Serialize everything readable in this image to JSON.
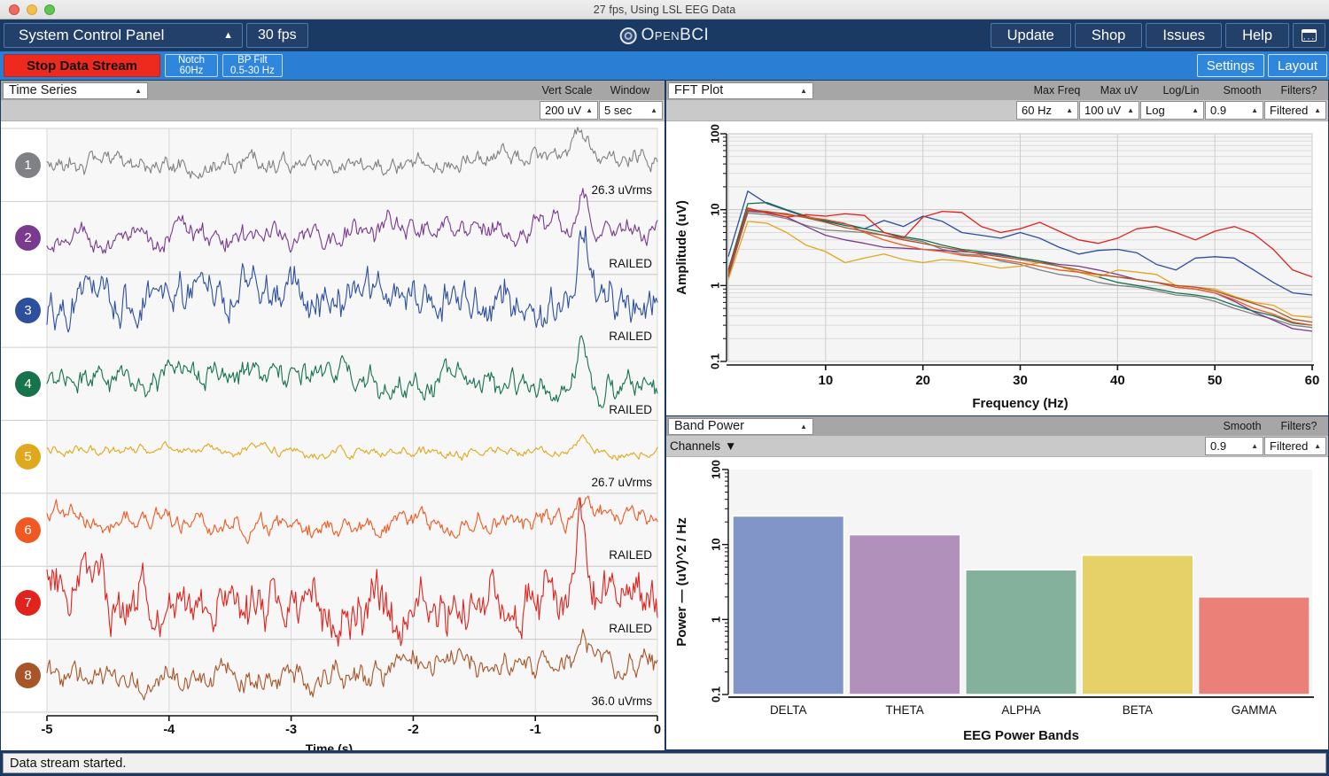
{
  "window": {
    "title": "27 fps, Using LSL EEG Data",
    "traffic_lights": [
      "close",
      "minimize",
      "zoom"
    ]
  },
  "navbar": {
    "system_control_panel": "System Control Panel",
    "caret": "▲",
    "fps": "30 fps",
    "logo": "OpenBCI",
    "update": "Update",
    "shop": "Shop",
    "issues": "Issues",
    "help": "Help",
    "window_icon": "window-icon"
  },
  "subbar": {
    "stop_button": "Stop Data Stream",
    "notch_line1": "Notch",
    "notch_line2": "60Hz",
    "bpfilt_line1": "BP Filt",
    "bpfilt_line2": "0.5-30 Hz",
    "settings": "Settings",
    "layout": "Layout"
  },
  "time_series": {
    "title": "Time Series",
    "controls": [
      {
        "label": "Vert Scale",
        "value": "200 uV"
      },
      {
        "label": "Window",
        "value": "5 sec"
      }
    ],
    "channels": [
      {
        "num": "1",
        "color": "#808184",
        "status": "26.3 uVrms"
      },
      {
        "num": "2",
        "color": "#7a3a8f",
        "status": "RAILED"
      },
      {
        "num": "3",
        "color": "#2c4f9e",
        "status": "RAILED"
      },
      {
        "num": "4",
        "color": "#16734b",
        "status": "RAILED"
      },
      {
        "num": "5",
        "color": "#e0a81c",
        "status": "26.7 uVrms"
      },
      {
        "num": "6",
        "color": "#f05a22",
        "status": "RAILED"
      },
      {
        "num": "7",
        "color": "#e1221d",
        "status": "RAILED"
      },
      {
        "num": "8",
        "color": "#a85529",
        "status": "36.0 uVrms"
      }
    ],
    "xlabel": "Time (s)",
    "xticks": [
      "-5",
      "-4",
      "-3",
      "-2",
      "-1",
      "0"
    ]
  },
  "fft": {
    "title": "FFT Plot",
    "controls": [
      {
        "label": "Max Freq",
        "value": "60 Hz"
      },
      {
        "label": "Max uV",
        "value": "100 uV"
      },
      {
        "label": "Log/Lin",
        "value": "Log"
      },
      {
        "label": "Smooth",
        "value": "0.9"
      },
      {
        "label": "Filters?",
        "value": "Filtered"
      }
    ]
  },
  "band_power": {
    "title": "Band Power",
    "channels_button": "Channels",
    "channels_caret": "▼",
    "controls": [
      {
        "label": "Smooth",
        "value": "0.9"
      },
      {
        "label": "Filters?",
        "value": "Filtered"
      }
    ]
  },
  "status": {
    "message": "Data stream started."
  },
  "colors": {
    "nav_blue": "#1b3a63",
    "sub_blue": "#2a7fd4",
    "stop_red": "#ee2a1e",
    "widget_header": "#a6a6a6"
  },
  "chart_data": [
    {
      "id": "fft",
      "type": "line",
      "title": "FFT Plot",
      "xlabel": "Frequency (Hz)",
      "ylabel": "Amplitude (uV)",
      "xlim": [
        0,
        60
      ],
      "ylim": [
        0.1,
        100
      ],
      "yscale": "log",
      "xticks": [
        10,
        20,
        30,
        40,
        50,
        60
      ],
      "yticks": [
        0.1,
        1,
        10,
        100
      ],
      "grid": true,
      "legend": "none",
      "x": [
        0,
        2,
        4,
        6,
        8,
        10,
        12,
        14,
        16,
        18,
        20,
        22,
        24,
        26,
        28,
        30,
        32,
        34,
        36,
        38,
        40,
        42,
        44,
        46,
        48,
        50,
        52,
        54,
        56,
        58,
        60
      ],
      "series": [
        {
          "name": "Ch 1",
          "color": "#808184",
          "values": [
            1.5,
            9.0,
            8.6,
            7.6,
            6.2,
            5.4,
            5.2,
            5.0,
            4.6,
            4.2,
            3.8,
            3.0,
            2.6,
            2.5,
            2.1,
            1.9,
            1.6,
            1.4,
            1.3,
            1.1,
            1.0,
            0.95,
            0.85,
            0.75,
            0.72,
            0.62,
            0.5,
            0.42,
            0.36,
            0.3,
            0.28
          ]
        },
        {
          "name": "Ch 2",
          "color": "#7a3a8f",
          "values": [
            1.3,
            9.5,
            9.2,
            8.0,
            6.0,
            4.6,
            4.0,
            3.6,
            3.2,
            3.1,
            3.0,
            2.9,
            2.8,
            2.7,
            2.5,
            2.3,
            2.1,
            1.9,
            1.8,
            1.6,
            1.4,
            1.2,
            1.1,
            0.95,
            0.9,
            0.8,
            0.62,
            0.45,
            0.35,
            0.27,
            0.25
          ]
        },
        {
          "name": "Ch 3",
          "color": "#2c4f9e",
          "values": [
            2.4,
            17.5,
            12.0,
            9.8,
            8.0,
            7.2,
            6.5,
            5.6,
            7.2,
            6.0,
            8.2,
            7.0,
            5.0,
            4.6,
            4.2,
            5.0,
            4.2,
            3.2,
            2.6,
            2.9,
            3.0,
            2.7,
            1.9,
            1.6,
            2.3,
            2.4,
            2.3,
            1.6,
            1.1,
            0.8,
            0.75
          ]
        },
        {
          "name": "Ch 4",
          "color": "#16734b",
          "values": [
            1.6,
            12.0,
            12.4,
            10.0,
            8.2,
            7.0,
            6.2,
            5.6,
            5.0,
            4.4,
            4.0,
            3.4,
            3.0,
            2.8,
            2.6,
            2.3,
            2.1,
            1.8,
            1.5,
            1.3,
            1.1,
            1.0,
            0.9,
            0.8,
            0.75,
            0.68,
            0.55,
            0.46,
            0.4,
            0.32,
            0.3
          ]
        },
        {
          "name": "Ch 5",
          "color": "#e0a81c",
          "values": [
            1.2,
            7.0,
            6.6,
            5.0,
            3.4,
            2.8,
            2.0,
            2.3,
            2.6,
            2.2,
            2.0,
            2.2,
            2.1,
            1.9,
            1.7,
            1.8,
            2.0,
            1.8,
            1.5,
            1.3,
            1.6,
            1.5,
            1.4,
            1.0,
            0.95,
            0.9,
            0.72,
            0.6,
            0.55,
            0.4,
            0.38
          ]
        },
        {
          "name": "Ch 6",
          "color": "#f05a22",
          "values": [
            1.4,
            10.0,
            9.5,
            8.5,
            8.0,
            7.4,
            6.6,
            5.0,
            4.0,
            3.4,
            3.0,
            2.8,
            2.5,
            2.4,
            2.2,
            2.0,
            1.8,
            1.6,
            1.5,
            1.4,
            1.3,
            1.2,
            1.1,
            0.95,
            0.9,
            0.8,
            0.65,
            0.5,
            0.42,
            0.33,
            0.3
          ]
        },
        {
          "name": "Ch 7",
          "color": "#e1221d",
          "values": [
            1.5,
            10.5,
            9.0,
            8.0,
            8.6,
            8.2,
            8.8,
            8.4,
            5.0,
            4.2,
            8.0,
            9.5,
            9.2,
            6.0,
            5.0,
            5.6,
            6.8,
            5.2,
            4.0,
            3.6,
            4.2,
            5.6,
            6.0,
            5.0,
            4.0,
            5.2,
            6.0,
            4.8,
            3.0,
            1.6,
            1.3
          ]
        },
        {
          "name": "Ch 8",
          "color": "#a85529",
          "values": [
            1.4,
            9.8,
            9.4,
            8.8,
            7.8,
            6.8,
            5.8,
            5.2,
            4.6,
            4.0,
            3.6,
            3.2,
            2.9,
            2.6,
            2.4,
            2.2,
            2.0,
            1.8,
            1.6,
            1.4,
            1.3,
            1.2,
            1.1,
            1.0,
            0.95,
            0.85,
            0.7,
            0.58,
            0.48,
            0.36,
            0.33
          ]
        }
      ]
    },
    {
      "id": "band_power",
      "type": "bar",
      "title": "Band Power",
      "xlabel": "EEG Power Bands",
      "ylabel": "Power — (uV)^2 / Hz",
      "categories": [
        "DELTA",
        "THETA",
        "ALPHA",
        "BETA",
        "GAMMA"
      ],
      "values": [
        24.0,
        13.5,
        4.6,
        7.2,
        2.0
      ],
      "colors": [
        "#8195c9",
        "#b191bb",
        "#83b19b",
        "#e6d169",
        "#ea8078"
      ],
      "ylim": [
        0.1,
        100
      ],
      "yscale": "log",
      "yticks": [
        0.1,
        1,
        10,
        100
      ],
      "grid": false
    }
  ]
}
